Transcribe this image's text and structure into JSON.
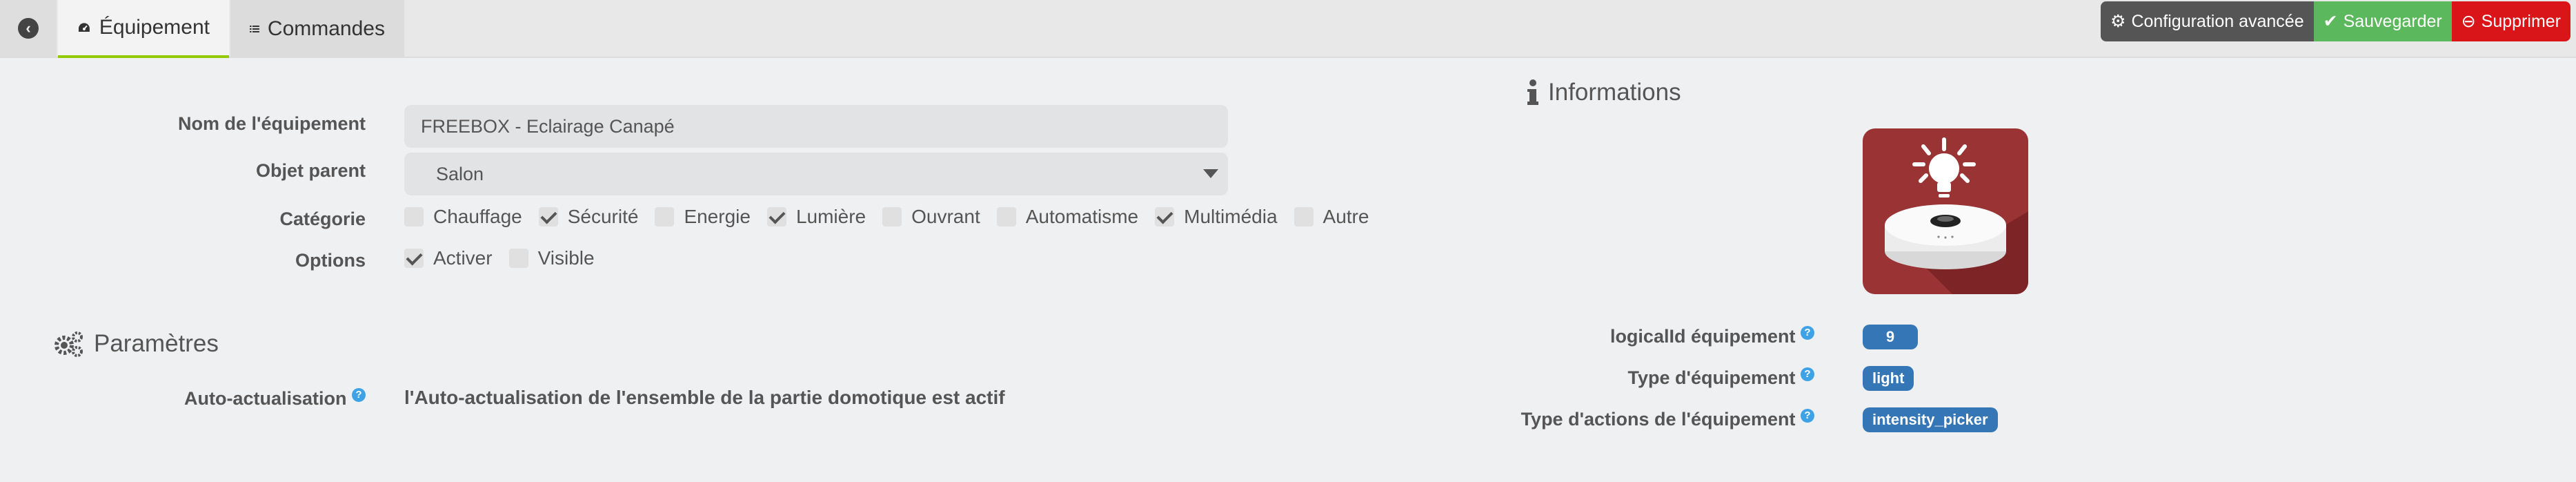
{
  "tabs": [
    {
      "label": "Équipement"
    },
    {
      "label": "Commandes"
    }
  ],
  "actions": {
    "config_label": "Configuration avancée",
    "save_label": "Sauvegarder",
    "delete_label": "Supprimer"
  },
  "form": {
    "name_label": "Nom de l'équipement",
    "name_value": "FREEBOX - Eclairage Canapé",
    "parent_label": "Objet parent",
    "parent_value": "Salon",
    "category_label": "Catégorie",
    "categories": [
      {
        "label": "Chauffage",
        "checked": false
      },
      {
        "label": "Sécurité",
        "checked": true
      },
      {
        "label": "Energie",
        "checked": false
      },
      {
        "label": "Lumière",
        "checked": true
      },
      {
        "label": "Ouvrant",
        "checked": false
      },
      {
        "label": "Automatisme",
        "checked": false
      },
      {
        "label": "Multimédia",
        "checked": true
      },
      {
        "label": "Autre",
        "checked": false
      }
    ],
    "options_label": "Options",
    "options": [
      {
        "label": "Activer",
        "checked": true
      },
      {
        "label": "Visible",
        "checked": false
      }
    ]
  },
  "params": {
    "title": "Paramètres",
    "auto_label": "Auto-actualisation",
    "auto_desc": "l'Auto-actualisation de l'ensemble de la partie domotique est actif"
  },
  "info": {
    "title": "Informations",
    "logical_label": "logicalId équipement",
    "logical_value": "9",
    "type_label": "Type d'équipement",
    "type_value": "light",
    "action_label": "Type d'actions de l'équipement",
    "action_value": "intensity_picker"
  },
  "help_symbol": "?"
}
